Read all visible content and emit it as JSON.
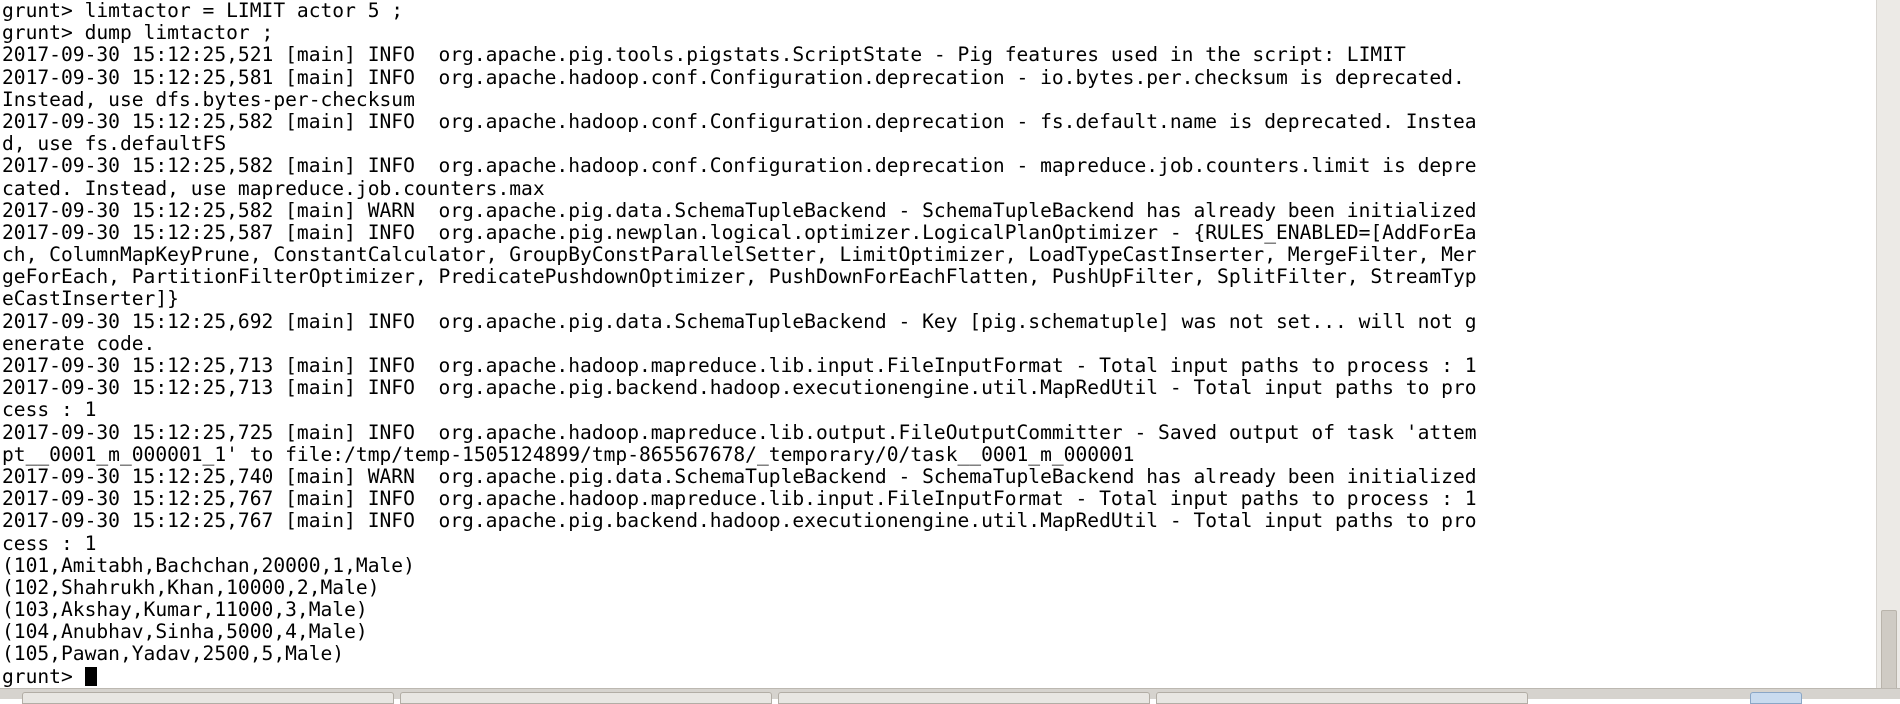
{
  "terminal": {
    "lines": [
      "grunt> limtactor = LIMIT actor 5 ;",
      "grunt> dump limtactor ;",
      "2017-09-30 15:12:25,521 [main] INFO  org.apache.pig.tools.pigstats.ScriptState - Pig features used in the script: LIMIT",
      "2017-09-30 15:12:25,581 [main] INFO  org.apache.hadoop.conf.Configuration.deprecation - io.bytes.per.checksum is deprecated.",
      "Instead, use dfs.bytes-per-checksum",
      "2017-09-30 15:12:25,582 [main] INFO  org.apache.hadoop.conf.Configuration.deprecation - fs.default.name is deprecated. Instea",
      "d, use fs.defaultFS",
      "2017-09-30 15:12:25,582 [main] INFO  org.apache.hadoop.conf.Configuration.deprecation - mapreduce.job.counters.limit is depre",
      "cated. Instead, use mapreduce.job.counters.max",
      "2017-09-30 15:12:25,582 [main] WARN  org.apache.pig.data.SchemaTupleBackend - SchemaTupleBackend has already been initialized",
      "2017-09-30 15:12:25,587 [main] INFO  org.apache.pig.newplan.logical.optimizer.LogicalPlanOptimizer - {RULES_ENABLED=[AddForEa",
      "ch, ColumnMapKeyPrune, ConstantCalculator, GroupByConstParallelSetter, LimitOptimizer, LoadTypeCastInserter, MergeFilter, Mer",
      "geForEach, PartitionFilterOptimizer, PredicatePushdownOptimizer, PushDownForEachFlatten, PushUpFilter, SplitFilter, StreamTyp",
      "eCastInserter]}",
      "2017-09-30 15:12:25,692 [main] INFO  org.apache.pig.data.SchemaTupleBackend - Key [pig.schematuple] was not set... will not g",
      "enerate code.",
      "2017-09-30 15:12:25,713 [main] INFO  org.apache.hadoop.mapreduce.lib.input.FileInputFormat - Total input paths to process : 1",
      "2017-09-30 15:12:25,713 [main] INFO  org.apache.pig.backend.hadoop.executionengine.util.MapRedUtil - Total input paths to pro",
      "cess : 1",
      "2017-09-30 15:12:25,725 [main] INFO  org.apache.hadoop.mapreduce.lib.output.FileOutputCommitter - Saved output of task 'attem",
      "pt__0001_m_000001_1' to file:/tmp/temp-1505124899/tmp-865567678/_temporary/0/task__0001_m_000001",
      "2017-09-30 15:12:25,740 [main] WARN  org.apache.pig.data.SchemaTupleBackend - SchemaTupleBackend has already been initialized",
      "2017-09-30 15:12:25,767 [main] INFO  org.apache.hadoop.mapreduce.lib.input.FileInputFormat - Total input paths to process : 1",
      "2017-09-30 15:12:25,767 [main] INFO  org.apache.pig.backend.hadoop.executionengine.util.MapRedUtil - Total input paths to pro",
      "cess : 1",
      "(101,Amitabh,Bachchan,20000,1,Male)",
      "(102,Shahrukh,Khan,10000,2,Male)",
      "(103,Akshay,Kumar,11000,3,Male)",
      "(104,Anubhav,Sinha,5000,4,Male)",
      "(105,Pawan,Yadav,2500,5,Male)"
    ],
    "prompt": "grunt> "
  }
}
